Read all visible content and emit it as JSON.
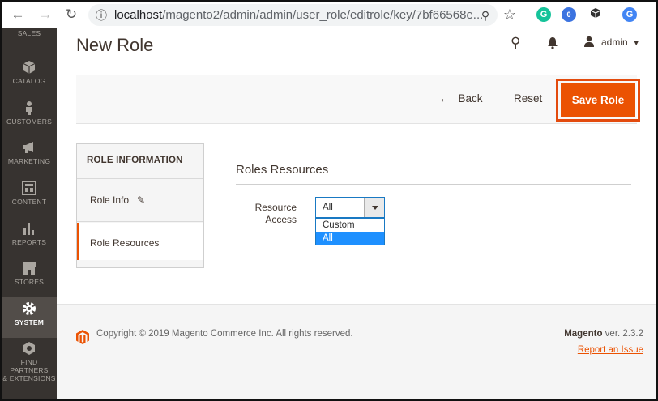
{
  "browser": {
    "url_host": "localhost",
    "url_path": "/magento2/admin/admin/user_role/editrole/key/7bf66568e...",
    "back_icon": "arrow-left-icon",
    "forward_icon": "arrow-right-icon",
    "reload_icon": "reload-icon",
    "extensions": [
      {
        "name": "grammarly-icon",
        "label": "G",
        "color": "#15c39a"
      },
      {
        "name": "extension-badge-icon",
        "label": "0",
        "color": "#3b73e0"
      },
      {
        "name": "cube-extension-icon",
        "label": "",
        "color": "#333"
      },
      {
        "name": "profile-avatar",
        "label": "G",
        "color": "#4285f4"
      }
    ]
  },
  "sidebar": {
    "items": [
      {
        "label": "SALES",
        "icon": "dollar-icon"
      },
      {
        "label": "CATALOG",
        "icon": "box-icon"
      },
      {
        "label": "CUSTOMERS",
        "icon": "person-icon"
      },
      {
        "label": "MARKETING",
        "icon": "megaphone-icon"
      },
      {
        "label": "CONTENT",
        "icon": "layout-icon"
      },
      {
        "label": "REPORTS",
        "icon": "bar-chart-icon"
      },
      {
        "label": "STORES",
        "icon": "store-icon"
      },
      {
        "label": "SYSTEM",
        "icon": "gear-icon",
        "active": true
      },
      {
        "label": "FIND PARTNERS",
        "label2": "& EXTENSIONS",
        "icon": "extensions-icon"
      }
    ]
  },
  "header": {
    "title": "New Role",
    "user": "admin"
  },
  "actions": {
    "back": "Back",
    "reset": "Reset",
    "save": "Save Role"
  },
  "tabs": {
    "title": "ROLE INFORMATION",
    "items": [
      {
        "label": "Role Info"
      },
      {
        "label": "Role Resources",
        "active": true
      }
    ]
  },
  "resources": {
    "section_title": "Roles Resources",
    "field_label_line1": "Resource",
    "field_label_line2": "Access",
    "selected": "All",
    "options": [
      "Custom",
      "All"
    ],
    "highlighted": "All"
  },
  "footer": {
    "copyright": "Copyright © 2019 Magento Commerce Inc. All rights reserved.",
    "brand": "Magento",
    "version": " ver. 2.3.2",
    "report": "Report an Issue"
  },
  "colors": {
    "accent": "#eb5202",
    "sidebar": "#373330",
    "select_border": "#1979c3",
    "option_highlight": "#1e90ff"
  }
}
